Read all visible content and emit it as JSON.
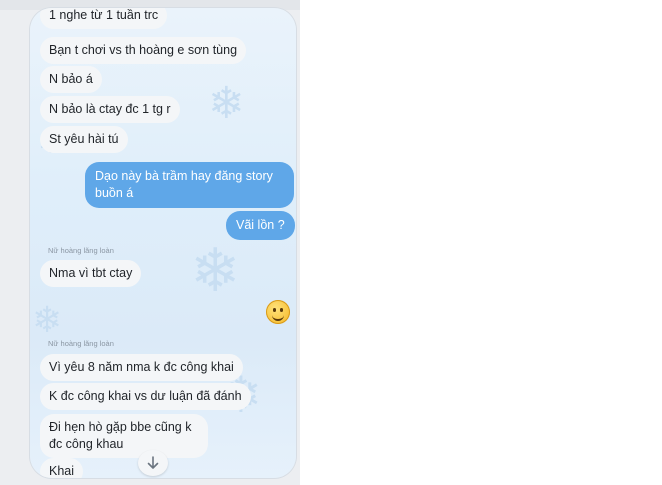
{
  "messages_in_top": [
    "1 nghe từ 1 tuần trc",
    "Bạn t chơi vs th hoàng e sơn tùng",
    "N bảo á",
    "N bảo là ctay đc 1 tg r",
    "St yêu hài tú"
  ],
  "messages_out": [
    "Dạo này bà trầm hay đăng story buồn á",
    "Vãi lồn ?"
  ],
  "group1": {
    "sender": "Nữ hoàng lăng loàn",
    "text": "Nma vì tbt ctay"
  },
  "group2": {
    "sender": "Nữ hoàng lăng loàn",
    "messages": [
      "Vì yêu 8 năm nma k đc công khai",
      "K đc công khai vs dư luận đã đánh",
      "Đi hẹn hò gặp bbe cũng k đc công khau",
      "Khai"
    ]
  },
  "icons": {
    "reaction": "grinning-face-emoji",
    "scroll_down": "arrow-down-icon"
  },
  "colors": {
    "outgoing_bubble": "#5fa7e8",
    "incoming_bubble": "#f4f6f8"
  }
}
